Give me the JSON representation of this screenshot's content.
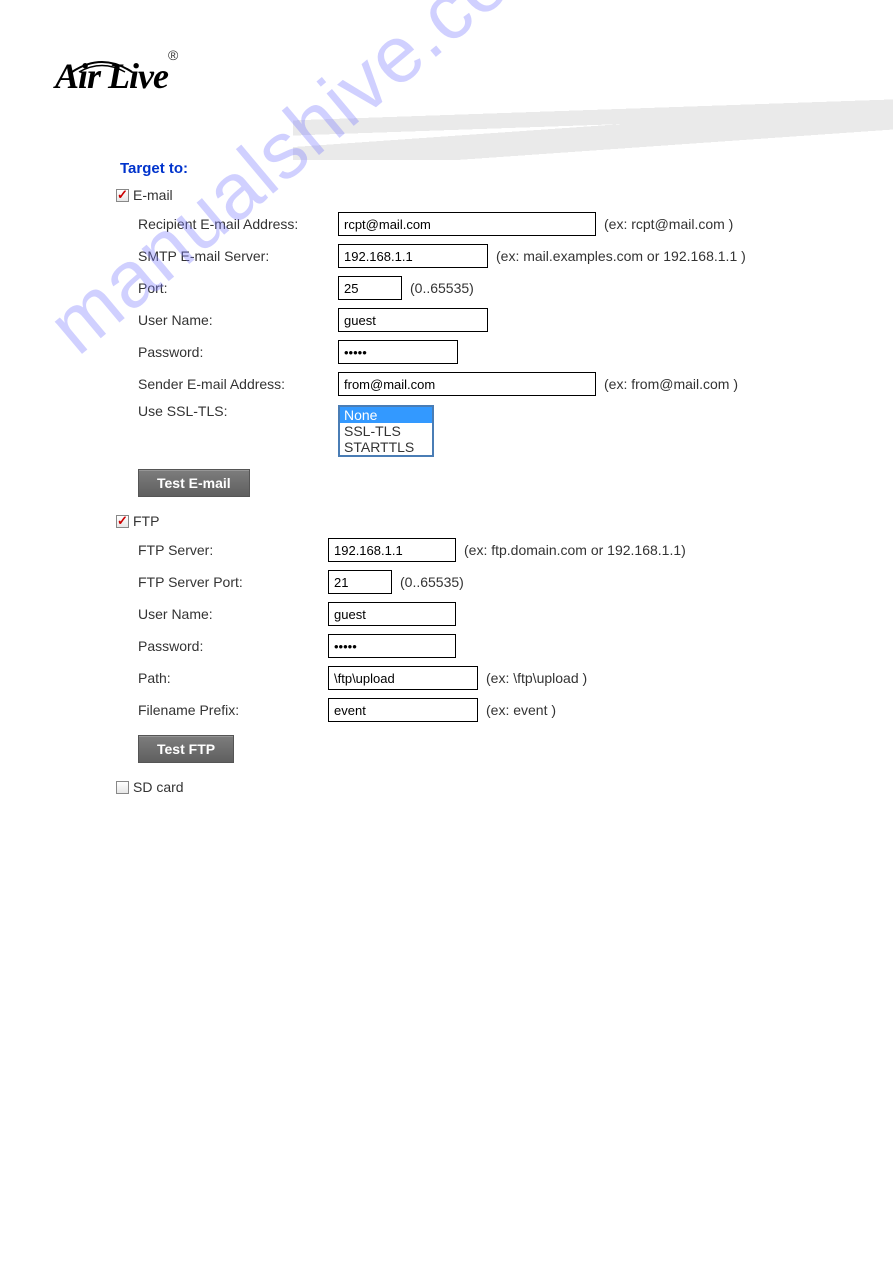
{
  "brand": "Air Live",
  "section_title": "Target to:",
  "watermark": "manualshive.com",
  "email": {
    "group_label": "E-mail",
    "checked": true,
    "recipient_label": "Recipient E-mail Address:",
    "recipient_value": "rcpt@mail.com",
    "recipient_hint": "(ex: rcpt@mail.com )",
    "smtp_label": "SMTP E-mail Server:",
    "smtp_value": "192.168.1.1",
    "smtp_hint": "(ex: mail.examples.com or 192.168.1.1 )",
    "port_label": "Port:",
    "port_value": "25",
    "port_hint": "(0..65535)",
    "user_label": "User Name:",
    "user_value": "guest",
    "pass_label": "Password:",
    "pass_value": "•••••",
    "sender_label": "Sender E-mail Address:",
    "sender_value": "from@mail.com",
    "sender_hint": "(ex: from@mail.com )",
    "ssl_label": "Use SSL-TLS:",
    "ssl_options": {
      "o0": "None",
      "o1": "SSL-TLS",
      "o2": "STARTTLS"
    },
    "test_btn": "Test E-mail"
  },
  "ftp": {
    "group_label": "FTP",
    "checked": true,
    "server_label": "FTP Server:",
    "server_value": "192.168.1.1",
    "server_hint": "(ex: ftp.domain.com or 192.168.1.1)",
    "port_label": "FTP Server Port:",
    "port_value": "21",
    "port_hint": "(0..65535)",
    "user_label": "User Name:",
    "user_value": "guest",
    "pass_label": "Password:",
    "pass_value": "•••••",
    "path_label": "Path:",
    "path_value": "\\ftp\\upload",
    "path_hint": "(ex: \\ftp\\upload )",
    "prefix_label": "Filename Prefix:",
    "prefix_value": "event",
    "prefix_hint": "(ex: event )",
    "test_btn": "Test FTP"
  },
  "sd": {
    "group_label": "SD card",
    "checked": false
  }
}
